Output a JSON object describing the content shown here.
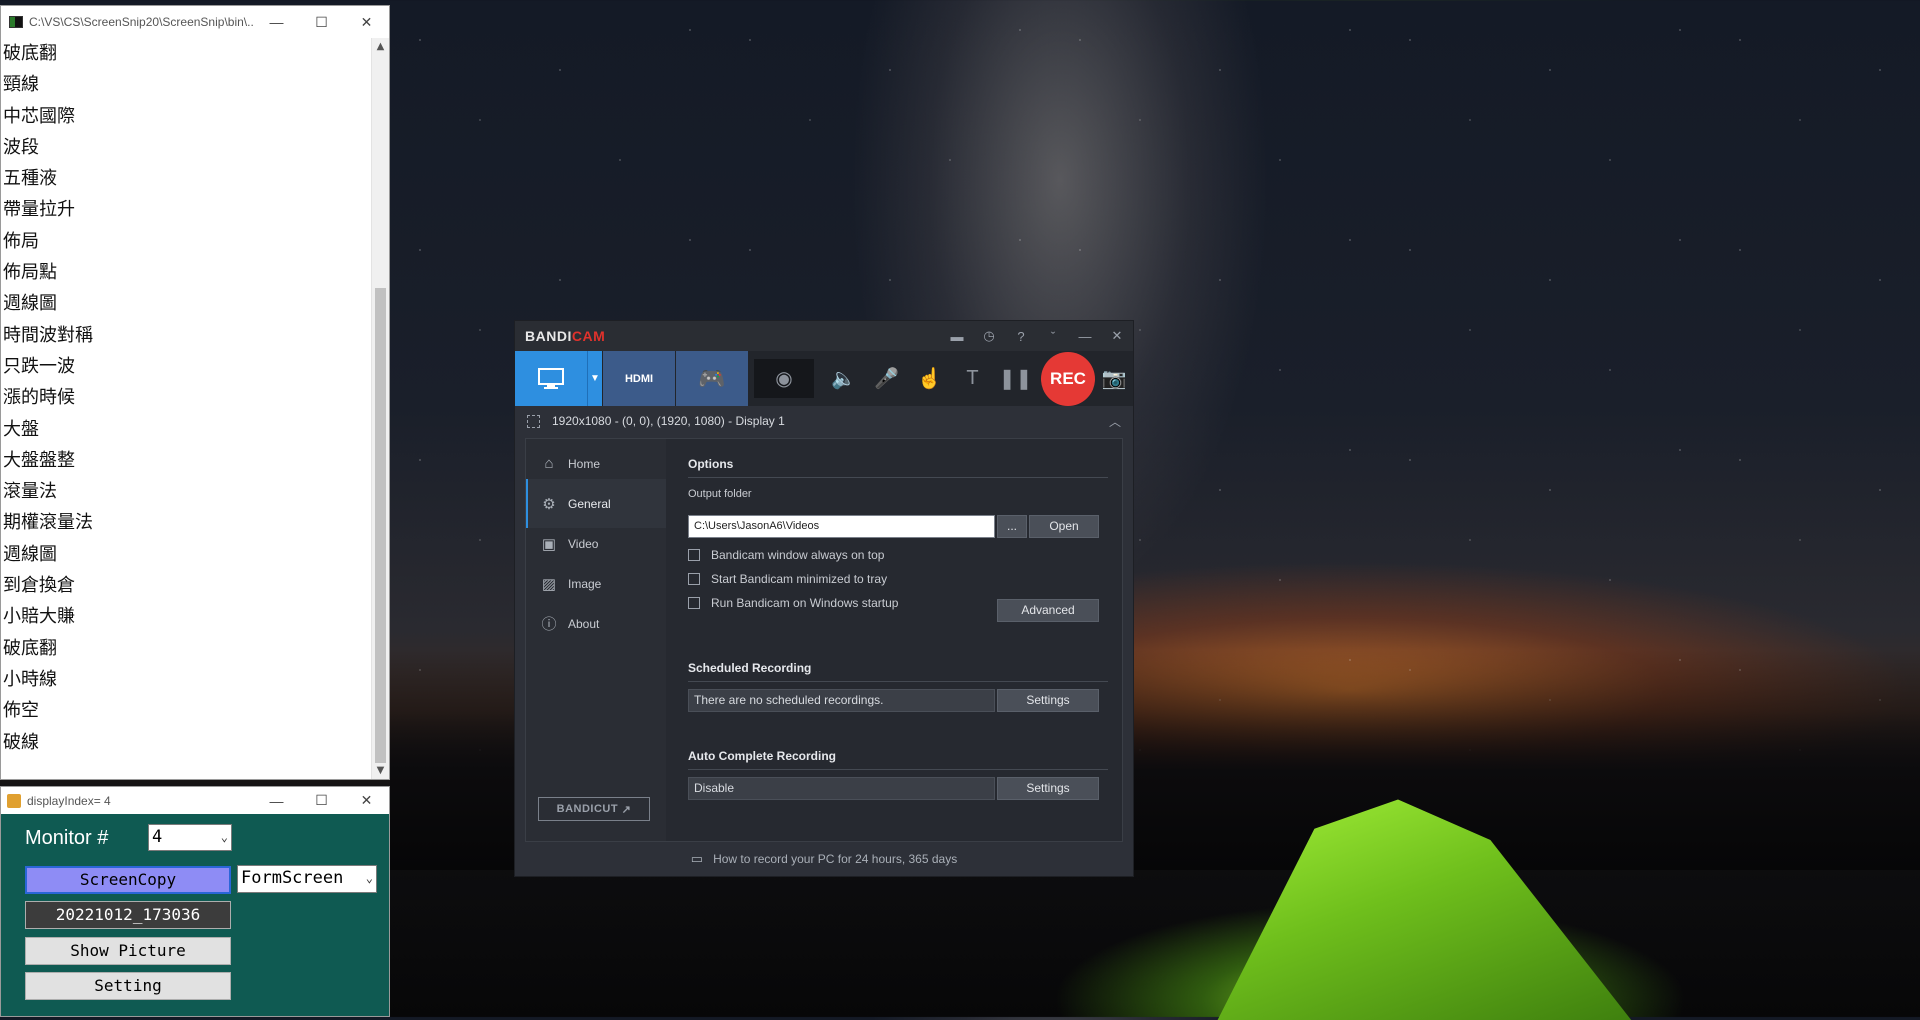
{
  "console": {
    "title": "C:\\VS\\CS\\ScreenSnip20\\ScreenSnip\\bin\\...",
    "lines": [
      "破底翻",
      "頸線",
      "中芯國際",
      "波段",
      "五種液",
      "帶量拉升",
      "佈局",
      "佈局點",
      "週線圖",
      "時間波對稱",
      "只跌一波",
      "漲的時候",
      "大盤",
      "大盤盤整",
      "滾量法",
      "期權滾量法",
      "週線圖",
      "到倉換倉",
      "小賠大賺",
      "破底翻",
      "小時線",
      "佈空",
      "破線"
    ]
  },
  "window_controls": {
    "minimize": "—",
    "maximize": "☐",
    "close": "✕"
  },
  "display_window": {
    "title": "displayIndex= 4",
    "monitor_label": "Monitor #",
    "monitor_value": "4",
    "screen_copy_button": "ScreenCopy",
    "mode_value": "FormScreen",
    "timestamp_button": "20221012_173036",
    "show_picture_button": "Show Picture",
    "setting_button": "Setting"
  },
  "bandicam": {
    "brand_part1": "BANDI",
    "brand_part2": "CAM",
    "hdmi_label": "HDMI",
    "rec_label": "REC",
    "region_text": "1920x1080 - (0, 0), (1920, 1080) - Display 1",
    "nav": [
      {
        "label": "Home",
        "icon": "home-icon"
      },
      {
        "label": "General",
        "icon": "gear-icon"
      },
      {
        "label": "Video",
        "icon": "video-icon"
      },
      {
        "label": "Image",
        "icon": "image-icon"
      },
      {
        "label": "About",
        "icon": "info-icon"
      }
    ],
    "bandicut_label": "BANDICUT",
    "options": {
      "title": "Options",
      "output_folder_label": "Output folder",
      "output_folder_value": "C:\\Users\\JasonA6\\Videos",
      "browse_button": "...",
      "open_button": "Open",
      "checkbox_always_on_top": "Bandicam window always on top",
      "checkbox_minimized": "Start Bandicam minimized to tray",
      "checkbox_startup": "Run Bandicam on Windows startup",
      "advanced_button": "Advanced"
    },
    "scheduled": {
      "title": "Scheduled Recording",
      "status": "There are no scheduled recordings.",
      "settings_button": "Settings"
    },
    "auto_complete": {
      "title": "Auto Complete Recording",
      "status": "Disable",
      "settings_button": "Settings"
    },
    "footer_text": "How to record your PC for 24 hours, 365 days"
  }
}
